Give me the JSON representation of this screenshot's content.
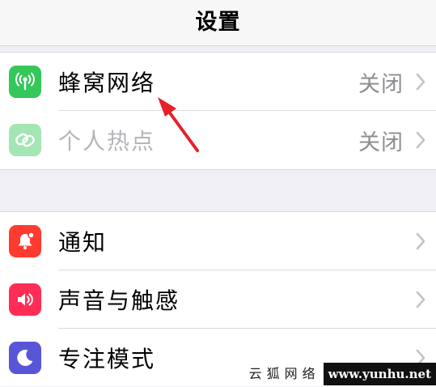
{
  "nav": {
    "title": "设置"
  },
  "group1": {
    "items": [
      {
        "label": "蜂窝网络",
        "value": "关闭",
        "icon": "cellular-antenna-icon",
        "icon_color": "#34c759"
      },
      {
        "label": "个人热点",
        "value": "关闭",
        "icon": "hotspot-link-icon",
        "icon_color": "#34c759",
        "disabled": true
      }
    ]
  },
  "group2": {
    "items": [
      {
        "label": "通知",
        "icon": "notification-bell-icon",
        "icon_color": "#ff3b30"
      },
      {
        "label": "声音与触感",
        "icon": "speaker-icon",
        "icon_color": "#ff2d55"
      },
      {
        "label": "专注模式",
        "icon": "moon-icon",
        "icon_color": "#5856d6"
      }
    ]
  },
  "annotation": {
    "arrow_color": "#e8202a"
  },
  "watermark": {
    "name": "云狐网络",
    "url": "www.yunhu.net"
  }
}
